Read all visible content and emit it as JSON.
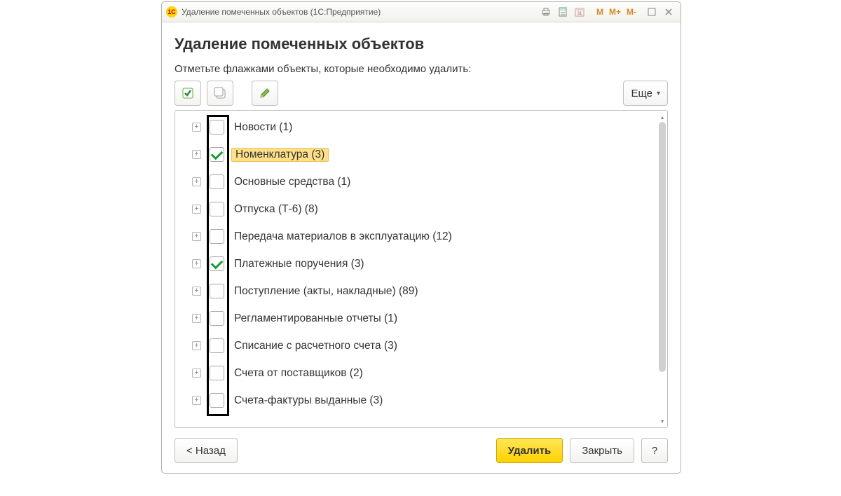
{
  "window": {
    "title": "Удаление помеченных объектов  (1С:Предприятие)"
  },
  "titlebar_icons": {
    "m1": "M",
    "m2": "M+",
    "m3": "M-"
  },
  "heading": "Удаление помеченных объектов",
  "instruction": "Отметьте флажками объекты, которые необходимо удалить:",
  "more_label": "Еще",
  "items": [
    {
      "label": "Новости (1)",
      "checked": false,
      "highlight": false
    },
    {
      "label": "Номенклатура (3)",
      "checked": true,
      "highlight": true
    },
    {
      "label": "Основные средства (1)",
      "checked": false,
      "highlight": false
    },
    {
      "label": "Отпуска (Т-6) (8)",
      "checked": false,
      "highlight": false
    },
    {
      "label": "Передача материалов в эксплуатацию (12)",
      "checked": false,
      "highlight": false
    },
    {
      "label": "Платежные поручения (3)",
      "checked": true,
      "highlight": false
    },
    {
      "label": "Поступление (акты, накладные) (89)",
      "checked": false,
      "highlight": false
    },
    {
      "label": "Регламентированные отчеты (1)",
      "checked": false,
      "highlight": false
    },
    {
      "label": "Списание с расчетного счета (3)",
      "checked": false,
      "highlight": false
    },
    {
      "label": "Счета от поставщиков (2)",
      "checked": false,
      "highlight": false
    },
    {
      "label": "Счета-фактуры выданные (3)",
      "checked": false,
      "highlight": false
    }
  ],
  "footer": {
    "back": "< Назад",
    "delete": "Удалить",
    "close": "Закрыть",
    "help": "?"
  }
}
